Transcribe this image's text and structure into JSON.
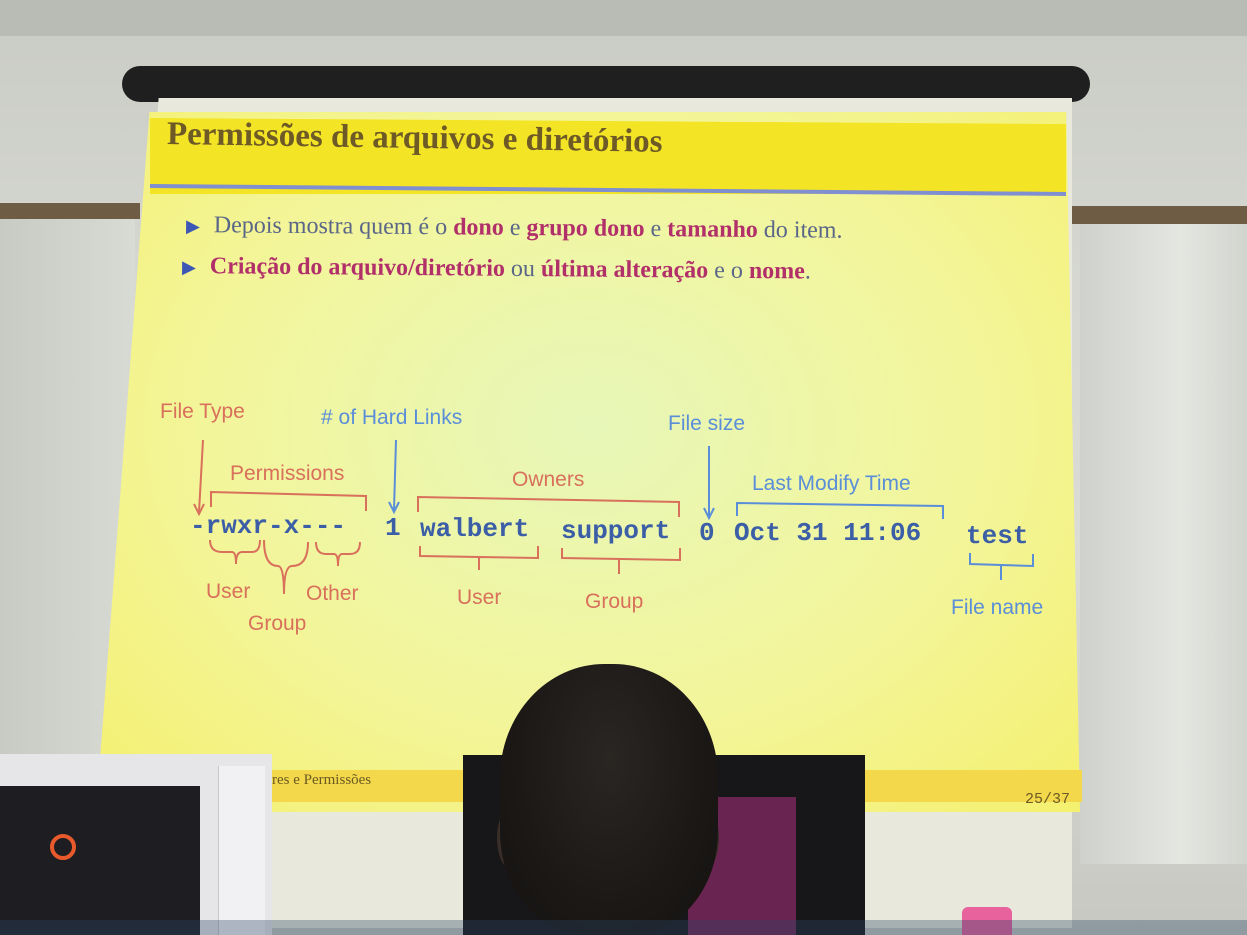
{
  "slide": {
    "title": "Permissões de arquivos e diretórios",
    "bullet1": {
      "t1": "Depois mostra quem é o ",
      "h1": "dono",
      "t2": " e ",
      "h2": "grupo dono",
      "t3": " e ",
      "h3": "tamanho",
      "t4": " do item."
    },
    "bullet2": {
      "h1": "Criação do arquivo/diretório",
      "t1": " ou ",
      "h2": "última alteração",
      "t2": " e o ",
      "h3": "nome",
      "t3": "."
    },
    "diagram": {
      "labels": {
        "file_type": "File Type",
        "hard_links": "# of Hard Links",
        "file_size": "File size",
        "permissions": "Permissions",
        "owners": "Owners",
        "last_modify": "Last Modify Time",
        "user": "User",
        "group": "Group",
        "other": "Other",
        "owner_user": "User",
        "owner_group": "Group",
        "file_name": "File name"
      },
      "listing": {
        "perms": "-rwxr-x---",
        "links": "1",
        "owner": "walbert",
        "group": "support",
        "size": "0",
        "date": "Oct 31 11:06",
        "name": "test"
      }
    },
    "footer_left": "res e Permissões",
    "page": "25/37"
  }
}
